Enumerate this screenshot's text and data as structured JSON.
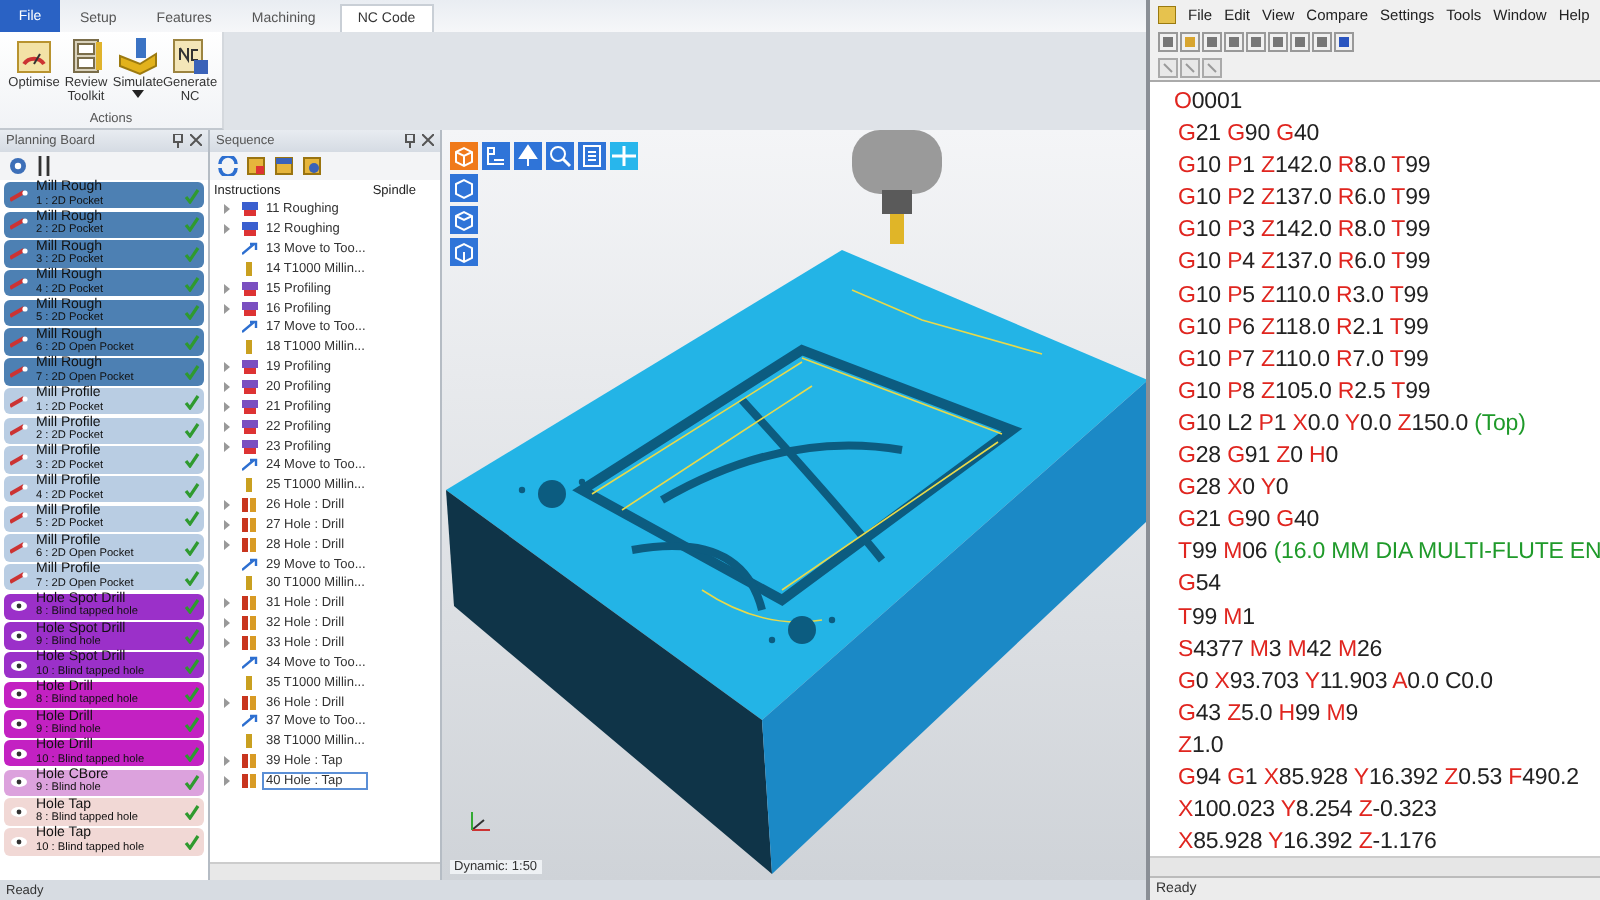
{
  "ribbon": {
    "tabs": [
      {
        "label": "File",
        "selected": false,
        "kind": "file"
      },
      {
        "label": "Setup",
        "selected": false,
        "kind": "tab"
      },
      {
        "label": "Features",
        "selected": false,
        "kind": "tab"
      },
      {
        "label": "Machining",
        "selected": false,
        "kind": "tab"
      },
      {
        "label": "NC Code",
        "selected": true,
        "kind": "tab"
      }
    ],
    "buttons": [
      {
        "label": "Optimise",
        "kind": "gauge"
      },
      {
        "label": "Review Toolkit",
        "kind": "cabinet"
      },
      {
        "label": "Simulate",
        "kind": "simulate",
        "dropdown": true
      },
      {
        "label": "Generate NC",
        "kind": "nc"
      }
    ],
    "group_label": "Actions"
  },
  "planning_board": {
    "title": "Planning Board",
    "items": [
      {
        "title": "Mill Rough",
        "subtitle": "1 : 2D Pocket",
        "color": "#4d80b3",
        "kind": "mill",
        "done": true
      },
      {
        "title": "Mill Rough",
        "subtitle": "2 : 2D Pocket",
        "color": "#4d80b3",
        "kind": "mill",
        "done": true
      },
      {
        "title": "Mill Rough",
        "subtitle": "3 : 2D Pocket",
        "color": "#4d80b3",
        "kind": "mill",
        "done": true
      },
      {
        "title": "Mill Rough",
        "subtitle": "4 : 2D Pocket",
        "color": "#4d80b3",
        "kind": "mill",
        "done": true
      },
      {
        "title": "Mill Rough",
        "subtitle": "5 : 2D Pocket",
        "color": "#4d80b3",
        "kind": "mill",
        "done": true
      },
      {
        "title": "Mill Rough",
        "subtitle": "6 : 2D Open Pocket",
        "color": "#4d80b3",
        "kind": "mill",
        "done": true
      },
      {
        "title": "Mill Rough",
        "subtitle": "7 : 2D Open Pocket",
        "color": "#4d80b3",
        "kind": "mill",
        "done": true
      },
      {
        "title": "Mill Profile",
        "subtitle": "1 : 2D Pocket",
        "color": "#b9cde3",
        "kind": "mill",
        "done": true
      },
      {
        "title": "Mill Profile",
        "subtitle": "2 : 2D Pocket",
        "color": "#b9cde3",
        "kind": "mill",
        "done": true
      },
      {
        "title": "Mill Profile",
        "subtitle": "3 : 2D Pocket",
        "color": "#b9cde3",
        "kind": "mill",
        "done": true
      },
      {
        "title": "Mill Profile",
        "subtitle": "4 : 2D Pocket",
        "color": "#b9cde3",
        "kind": "mill",
        "done": true
      },
      {
        "title": "Mill Profile",
        "subtitle": "5 : 2D Pocket",
        "color": "#b9cde3",
        "kind": "mill",
        "done": true
      },
      {
        "title": "Mill Profile",
        "subtitle": "6 : 2D Open Pocket",
        "color": "#b9cde3",
        "kind": "mill",
        "done": true
      },
      {
        "title": "Mill Profile",
        "subtitle": "7 : 2D Open Pocket",
        "color": "#b9cde3",
        "kind": "mill",
        "done": true
      },
      {
        "title": "Hole Spot Drill",
        "subtitle": "8 : Blind tapped hole",
        "color": "#9b30c9",
        "kind": "hole",
        "done": true
      },
      {
        "title": "Hole Spot Drill",
        "subtitle": "9 : Blind hole",
        "color": "#9b30c9",
        "kind": "hole",
        "done": true
      },
      {
        "title": "Hole Spot Drill",
        "subtitle": "10 : Blind tapped hole",
        "color": "#9b30c9",
        "kind": "hole",
        "done": true
      },
      {
        "title": "Hole Drill",
        "subtitle": "8 : Blind tapped hole",
        "color": "#c321c2",
        "kind": "hole",
        "done": true
      },
      {
        "title": "Hole Drill",
        "subtitle": "9 : Blind hole",
        "color": "#c321c2",
        "kind": "hole",
        "done": true
      },
      {
        "title": "Hole Drill",
        "subtitle": "10 : Blind tapped hole",
        "color": "#c321c2",
        "kind": "hole",
        "done": true
      },
      {
        "title": "Hole CBore",
        "subtitle": "9 : Blind hole",
        "color": "#dca2dd",
        "kind": "hole",
        "done": true
      },
      {
        "title": "Hole Tap",
        "subtitle": "8 : Blind tapped hole",
        "color": "#f1d8d5",
        "kind": "hole",
        "done": true
      },
      {
        "title": "Hole Tap",
        "subtitle": "10 : Blind tapped hole",
        "color": "#f1d8d5",
        "kind": "hole",
        "done": true
      }
    ]
  },
  "sequence": {
    "title": "Sequence",
    "columns": [
      "Instructions",
      "Spindle"
    ],
    "items": [
      {
        "label": "11 Roughing",
        "kind": "rough",
        "selected": false
      },
      {
        "label": "12 Roughing",
        "kind": "rough",
        "selected": false
      },
      {
        "label": "13 Move to Too...",
        "kind": "move",
        "selected": false
      },
      {
        "label": "14 T1000 Millin...",
        "kind": "tool",
        "selected": false
      },
      {
        "label": "15 Profiling",
        "kind": "profile",
        "selected": false
      },
      {
        "label": "16 Profiling",
        "kind": "profile",
        "selected": false
      },
      {
        "label": "17 Move to Too...",
        "kind": "move",
        "selected": false
      },
      {
        "label": "18 T1000 Millin...",
        "kind": "tool",
        "selected": false
      },
      {
        "label": "19 Profiling",
        "kind": "profile",
        "selected": false
      },
      {
        "label": "20 Profiling",
        "kind": "profile",
        "selected": false
      },
      {
        "label": "21 Profiling",
        "kind": "profile",
        "selected": false
      },
      {
        "label": "22 Profiling",
        "kind": "profile",
        "selected": false
      },
      {
        "label": "23 Profiling",
        "kind": "profile",
        "selected": false
      },
      {
        "label": "24 Move to Too...",
        "kind": "move",
        "selected": false
      },
      {
        "label": "25 T1000 Millin...",
        "kind": "tool",
        "selected": false
      },
      {
        "label": "26 Hole : Drill",
        "kind": "hole",
        "selected": false
      },
      {
        "label": "27 Hole : Drill",
        "kind": "hole",
        "selected": false
      },
      {
        "label": "28 Hole : Drill",
        "kind": "hole",
        "selected": false
      },
      {
        "label": "29 Move to Too...",
        "kind": "move",
        "selected": false
      },
      {
        "label": "30 T1000 Millin...",
        "kind": "tool",
        "selected": false
      },
      {
        "label": "31 Hole : Drill",
        "kind": "hole",
        "selected": false
      },
      {
        "label": "32 Hole : Drill",
        "kind": "hole",
        "selected": false
      },
      {
        "label": "33 Hole : Drill",
        "kind": "hole",
        "selected": false
      },
      {
        "label": "34 Move to Too...",
        "kind": "move",
        "selected": false
      },
      {
        "label": "35 T1000 Millin...",
        "kind": "tool",
        "selected": false
      },
      {
        "label": "36 Hole : Drill",
        "kind": "hole",
        "selected": false
      },
      {
        "label": "37 Move to Too...",
        "kind": "move",
        "selected": false
      },
      {
        "label": "38 T1000 Millin...",
        "kind": "tool",
        "selected": false
      },
      {
        "label": "39 Hole : Tap",
        "kind": "hole",
        "selected": false
      },
      {
        "label": "40 Hole : Tap",
        "kind": "hole",
        "selected": true
      }
    ]
  },
  "viewport": {
    "zoom_label": "Dynamic: 1:50"
  },
  "status_bar": {
    "text": "Ready"
  },
  "nc_editor": {
    "menu": [
      "File",
      "Edit",
      "View",
      "Compare",
      "Settings",
      "Tools",
      "Window",
      "Help"
    ],
    "lines": [
      [
        {
          "address": "O",
          "value": "0001"
        }
      ],
      [
        {
          "address": "G",
          "value": "21"
        },
        {
          "address": "G",
          "value": "90"
        },
        {
          "address": "G",
          "value": "40"
        }
      ],
      [
        {
          "address": "G",
          "value": "10"
        },
        {
          "address": "P",
          "value": "1"
        },
        {
          "address": "Z",
          "value": "142.0"
        },
        {
          "address": "R",
          "value": "8.0"
        },
        {
          "address": "T",
          "value": "99"
        }
      ],
      [
        {
          "address": "G",
          "value": "10"
        },
        {
          "address": "P",
          "value": "2"
        },
        {
          "address": "Z",
          "value": "137.0"
        },
        {
          "address": "R",
          "value": "6.0"
        },
        {
          "address": "T",
          "value": "99"
        }
      ],
      [
        {
          "address": "G",
          "value": "10"
        },
        {
          "address": "P",
          "value": "3"
        },
        {
          "address": "Z",
          "value": "142.0"
        },
        {
          "address": "R",
          "value": "8.0"
        },
        {
          "address": "T",
          "value": "99"
        }
      ],
      [
        {
          "address": "G",
          "value": "10"
        },
        {
          "address": "P",
          "value": "4"
        },
        {
          "address": "Z",
          "value": "137.0"
        },
        {
          "address": "R",
          "value": "6.0"
        },
        {
          "address": "T",
          "value": "99"
        }
      ],
      [
        {
          "address": "G",
          "value": "10"
        },
        {
          "address": "P",
          "value": "5"
        },
        {
          "address": "Z",
          "value": "110.0"
        },
        {
          "address": "R",
          "value": "3.0"
        },
        {
          "address": "T",
          "value": "99"
        }
      ],
      [
        {
          "address": "G",
          "value": "10"
        },
        {
          "address": "P",
          "value": "6"
        },
        {
          "address": "Z",
          "value": "118.0"
        },
        {
          "address": "R",
          "value": "2.1"
        },
        {
          "address": "T",
          "value": "99"
        }
      ],
      [
        {
          "address": "G",
          "value": "10"
        },
        {
          "address": "P",
          "value": "7"
        },
        {
          "address": "Z",
          "value": "110.0"
        },
        {
          "address": "R",
          "value": "7.0"
        },
        {
          "address": "T",
          "value": "99"
        }
      ],
      [
        {
          "address": "G",
          "value": "10"
        },
        {
          "address": "P",
          "value": "8"
        },
        {
          "address": "Z",
          "value": "105.0"
        },
        {
          "address": "R",
          "value": "2.5"
        },
        {
          "address": "T",
          "value": "99"
        }
      ],
      [
        {
          "address": "G",
          "value": "10"
        },
        {
          "value": "L2"
        },
        {
          "address": "P",
          "value": "1"
        },
        {
          "address": "X",
          "value": "0.0"
        },
        {
          "address": "Y",
          "value": "0.0"
        },
        {
          "address": "Z",
          "value": "150.0"
        },
        {
          "comment": "(Top)"
        }
      ],
      [
        {
          "address": "G",
          "value": "28"
        },
        {
          "address": "G",
          "value": "91"
        },
        {
          "address": "Z",
          "value": "0"
        },
        {
          "address": "H",
          "value": "0"
        }
      ],
      [
        {
          "address": "G",
          "value": "28"
        },
        {
          "address": "X",
          "value": "0"
        },
        {
          "address": "Y",
          "value": "0"
        }
      ],
      [
        {
          "address": "G",
          "value": "21"
        },
        {
          "address": "G",
          "value": "90"
        },
        {
          "address": "G",
          "value": "40"
        }
      ],
      [
        {
          "address": "T",
          "value": "99"
        },
        {
          "address": "M",
          "value": "06"
        },
        {
          "comment": "(16.0 MM DIA MULTI-FLUTE EN"
        }
      ],
      [
        {
          "address": "G",
          "value": "54"
        }
      ],
      [
        {
          "address": "T",
          "value": "99"
        },
        {
          "address": "M",
          "value": "1"
        }
      ],
      [
        {
          "address": "S",
          "value": "4377"
        },
        {
          "address": "M",
          "value": "3"
        },
        {
          "address": "M",
          "value": "42"
        },
        {
          "address": "M",
          "value": "26"
        }
      ],
      [
        {
          "address": "G",
          "value": "0"
        },
        {
          "address": "X",
          "value": "93.703"
        },
        {
          "address": "Y",
          "value": "11.903"
        },
        {
          "address": "A",
          "value": "0.0"
        },
        {
          "value": "C0.0"
        }
      ],
      [
        {
          "address": "G",
          "value": "43"
        },
        {
          "address": "Z",
          "value": "5.0"
        },
        {
          "address": "H",
          "value": "99"
        },
        {
          "address": "M",
          "value": "9"
        }
      ],
      [
        {
          "address": "Z",
          "value": "1.0"
        }
      ],
      [
        {
          "address": "G",
          "value": "94"
        },
        {
          "address": "G",
          "value": "1"
        },
        {
          "address": "X",
          "value": "85.928"
        },
        {
          "address": "Y",
          "value": "16.392"
        },
        {
          "address": "Z",
          "value": "0.53"
        },
        {
          "address": "F",
          "value": "490.2"
        }
      ],
      [
        {
          "address": "X",
          "value": "100.023"
        },
        {
          "address": "Y",
          "value": "8.254"
        },
        {
          "address": "Z",
          "value": "-0.323"
        }
      ],
      [
        {
          "address": "X",
          "value": "85.928"
        },
        {
          "address": "Y",
          "value": "16.392"
        },
        {
          "address": "Z",
          "value": "-1.176"
        }
      ]
    ],
    "status": "Ready"
  }
}
